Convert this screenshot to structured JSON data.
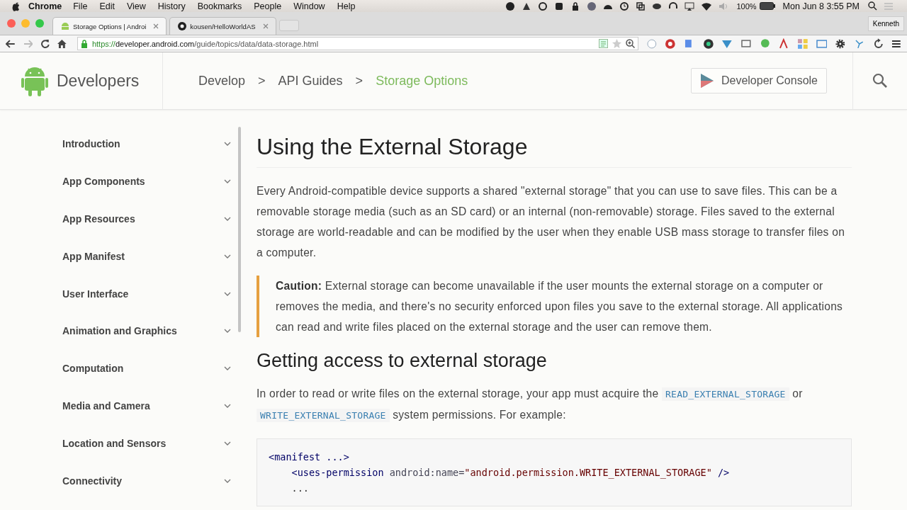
{
  "menubar": {
    "app": "Chrome",
    "menus": [
      "File",
      "Edit",
      "View",
      "History",
      "Bookmarks",
      "People",
      "Window",
      "Help"
    ],
    "battery": "100%",
    "clock": "Mon Jun 8  3:55 PM"
  },
  "tabs": [
    {
      "title": "Storage Options | Androi",
      "selected": true,
      "kind": "android"
    },
    {
      "title": "kousen/HelloWorldAS",
      "selected": false,
      "kind": "github"
    }
  ],
  "profile": "Kenneth",
  "address": {
    "scheme": "https://",
    "host": "developer.android.com",
    "path": "/guide/topics/data/data-storage.html"
  },
  "header": {
    "logo": "Developers",
    "breadcrumbs": [
      {
        "kind": "crumb",
        "label": "Develop",
        "selected": false
      },
      {
        "kind": "sep",
        "label": ">"
      },
      {
        "kind": "crumb",
        "label": "API Guides",
        "selected": false
      },
      {
        "kind": "sep",
        "label": ">"
      },
      {
        "kind": "crumb",
        "label": "Storage Options",
        "selected": true
      }
    ],
    "console_button": "Developer Console"
  },
  "sidebar": [
    {
      "label": "Introduction",
      "expanded": false
    },
    {
      "label": "App Components",
      "expanded": false
    },
    {
      "label": "App Resources",
      "expanded": false
    },
    {
      "label": "App Manifest",
      "expanded": false
    },
    {
      "label": "User Interface",
      "expanded": false
    },
    {
      "label": "Animation and Graphics",
      "expanded": false
    },
    {
      "label": "Computation",
      "expanded": false
    },
    {
      "label": "Media and Camera",
      "expanded": false
    },
    {
      "label": "Location and Sensors",
      "expanded": false
    },
    {
      "label": "Connectivity",
      "expanded": false
    }
  ],
  "article": [
    {
      "kind": "h1",
      "text": "Using the External Storage"
    },
    {
      "kind": "p",
      "parts": [
        {
          "kind": "text",
          "text": "Every Android-compatible device supports a shared \"external storage\" that you can use to save files. This can be a removable storage media (such as an SD card) or an internal (non-removable) storage. Files saved to the external storage are world-readable and can be modified by the user when they enable USB mass storage to transfer files on a computer."
        }
      ]
    },
    {
      "kind": "caution",
      "label": "Caution:",
      "text": "External storage can become unavailable if the user mounts the external storage on a computer or removes the media, and there's no security enforced upon files you save to the external storage. All applications can read and write files placed on the external storage and the user can remove them."
    },
    {
      "kind": "h2",
      "text": "Getting access to external storage"
    },
    {
      "kind": "p",
      "parts": [
        {
          "kind": "text",
          "text": "In order to read or write files on the external storage, your app must acquire the "
        },
        {
          "kind": "code",
          "text": "READ_EXTERNAL_STORAGE"
        },
        {
          "kind": "text",
          "text": " or "
        },
        {
          "kind": "code",
          "text": "WRITE_EXTERNAL_STORAGE"
        },
        {
          "kind": "text",
          "text": " system permissions. For example:"
        }
      ]
    },
    {
      "kind": "code",
      "lines": [
        [
          {
            "kind": "tag",
            "text": "<manifest ...>"
          }
        ],
        [
          {
            "kind": "tag",
            "text": "    <uses-permission"
          },
          {
            "kind": "attr",
            "text": " android:name="
          },
          {
            "kind": "string",
            "text": "\"android.permission.WRITE_EXTERNAL_STORAGE\""
          },
          {
            "kind": "tag",
            "text": " />"
          }
        ],
        [
          {
            "kind": "plain",
            "text": "    ..."
          }
        ]
      ]
    }
  ]
}
